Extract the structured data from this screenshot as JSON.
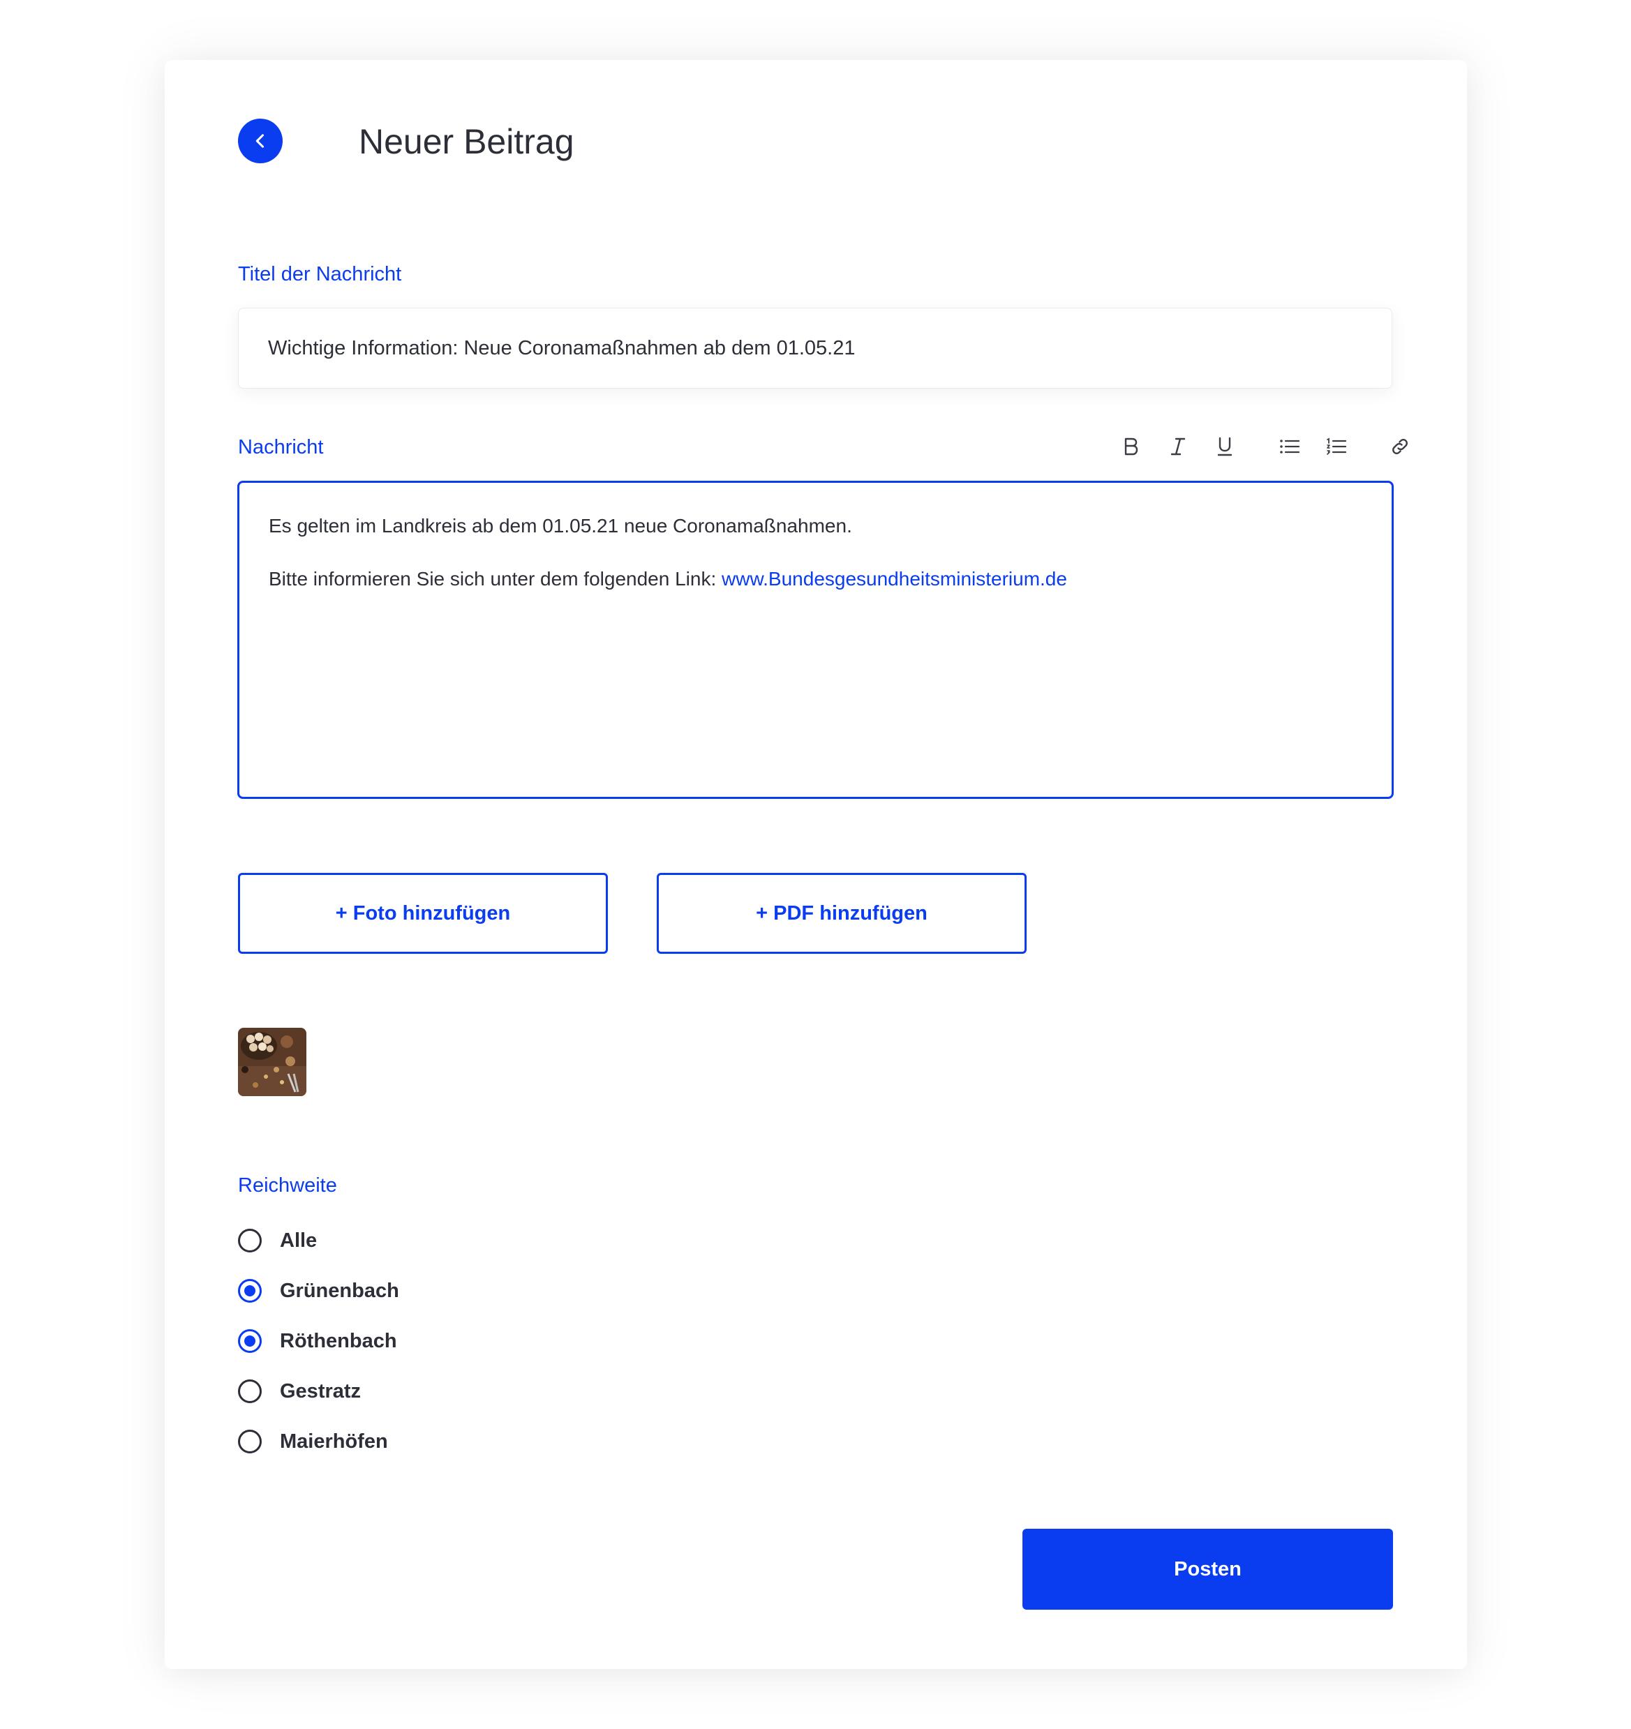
{
  "header": {
    "title": "Neuer Beitrag",
    "back_icon": "chevron-left-icon"
  },
  "title_field": {
    "label": "Titel der Nachricht",
    "value": "Wichtige Information: Neue Coronamaßnahmen ab dem 01.05.21"
  },
  "message": {
    "label": "Nachricht",
    "toolbar": [
      "bold-icon",
      "italic-icon",
      "underline-icon",
      "bullet-list-icon",
      "numbered-list-icon",
      "link-icon"
    ],
    "line1": "Es gelten im Landkreis ab dem 01.05.21 neue Coronamaßnahmen.",
    "line2_prefix": "Bitte informieren Sie sich unter dem folgenden Link: ",
    "line2_link": "www.Bundesgesundheitsministerium.de"
  },
  "attachments": {
    "photo_button": "+ Foto hinzufügen",
    "pdf_button": "+ PDF hinzufügen",
    "thumbnail": "photo-thumbnail"
  },
  "reach": {
    "label": "Reichweite",
    "options": [
      {
        "label": "Alle",
        "checked": false
      },
      {
        "label": "Grünenbach",
        "checked": true
      },
      {
        "label": "Röthenbach",
        "checked": true
      },
      {
        "label": "Gestratz",
        "checked": false
      },
      {
        "label": "Maierhöfen",
        "checked": false
      }
    ]
  },
  "submit": {
    "label": "Posten"
  },
  "colors": {
    "accent": "#0A3CF0",
    "text": "#2d2f38"
  }
}
